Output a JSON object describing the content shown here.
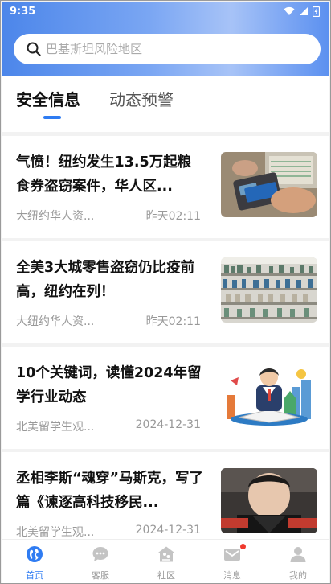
{
  "status_bar": {
    "time": "9:35"
  },
  "search": {
    "placeholder": "巴基斯坦风险地区"
  },
  "tabs": [
    {
      "label": "安全信息",
      "active": true
    },
    {
      "label": "动态预警",
      "active": false
    }
  ],
  "articles": [
    {
      "title": "气愤！纽约发生13.5万起粮食券盗窃案件，华人区...",
      "source": "大纽约华人资...",
      "time": "昨天02:11",
      "thumb": "card-swipe-photo"
    },
    {
      "title": "全美3大城零售盗窃仍比疫前高，纽约在列！",
      "source": "大纽约华人资...",
      "time": "昨天02:11",
      "thumb": "store-shelves-photo"
    },
    {
      "title": "10个关键词，读懂2024年留学行业动态",
      "source": "北美留学生观...",
      "time": "2024-12-31",
      "thumb": "study-abroad-illustration"
    },
    {
      "title": "丞相李斯“魂穿”马斯克，写了篇《谏逐高科技移民...",
      "source": "北美留学生观...",
      "time": "2024-12-31",
      "thumb": "portrait-photo"
    }
  ],
  "tabbar": [
    {
      "label": "首页",
      "icon": "globe-icon",
      "active": true
    },
    {
      "label": "客服",
      "icon": "chat-bubble-icon",
      "active": false
    },
    {
      "label": "社区",
      "icon": "community-house-icon",
      "active": false
    },
    {
      "label": "消息",
      "icon": "mail-icon",
      "active": false,
      "badge": true
    },
    {
      "label": "我的",
      "icon": "person-icon",
      "active": false
    }
  ],
  "colors": {
    "accent": "#2f7cf2",
    "badge": "#f03a2e",
    "header_gradient": [
      "#4c86ea",
      "#a7c3f7"
    ]
  }
}
